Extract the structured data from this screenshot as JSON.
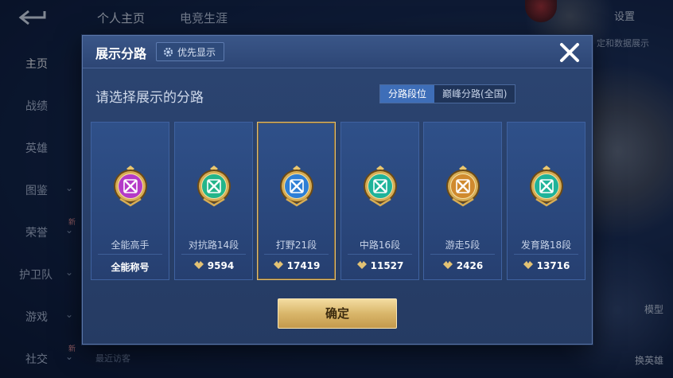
{
  "background": {
    "top_tabs": [
      "个人主页",
      "电竞生涯"
    ],
    "settings_label": "设置",
    "right_hint": "定和数据展示",
    "side_nav": [
      {
        "label": "主页",
        "active": true
      },
      {
        "label": "战绩",
        "active": false
      },
      {
        "label": "英雄",
        "active": false
      },
      {
        "label": "图鉴",
        "active": false
      },
      {
        "label": "荣誉",
        "active": false
      },
      {
        "label": "护卫队",
        "active": false
      },
      {
        "label": "游戏",
        "active": false
      },
      {
        "label": "社交",
        "active": false
      }
    ],
    "new_badge": "新",
    "visitors_label": "最近访客",
    "right_buttons": [
      "模型",
      "换英雄"
    ]
  },
  "dialog": {
    "title": "展示分路",
    "priority_label": "优先显示",
    "subtitle": "请选择展示的分路",
    "segment": {
      "options": [
        "分路段位",
        "巅峰分路(全国)"
      ],
      "selected": 0
    },
    "cards": [
      {
        "name": "全能高手",
        "score": "全能称号",
        "emblem": "all-round-emblem",
        "color": "#b43ac8",
        "selected": false,
        "show_points_icon": false
      },
      {
        "name": "对抗路14段",
        "score": "9594",
        "emblem": "clash-lane-emblem",
        "color": "#23b58a",
        "selected": false,
        "show_points_icon": true
      },
      {
        "name": "打野21段",
        "score": "17419",
        "emblem": "jungle-emblem",
        "color": "#2e7fd6",
        "selected": true,
        "show_points_icon": true
      },
      {
        "name": "中路16段",
        "score": "11527",
        "emblem": "mid-lane-emblem",
        "color": "#1fb39a",
        "selected": false,
        "show_points_icon": true
      },
      {
        "name": "游走5段",
        "score": "2426",
        "emblem": "roam-emblem",
        "color": "#d08a2e",
        "selected": false,
        "show_points_icon": true
      },
      {
        "name": "发育路18段",
        "score": "13716",
        "emblem": "farm-lane-emblem",
        "color": "#1fb39a",
        "selected": false,
        "show_points_icon": true
      }
    ],
    "confirm_label": "确定"
  }
}
